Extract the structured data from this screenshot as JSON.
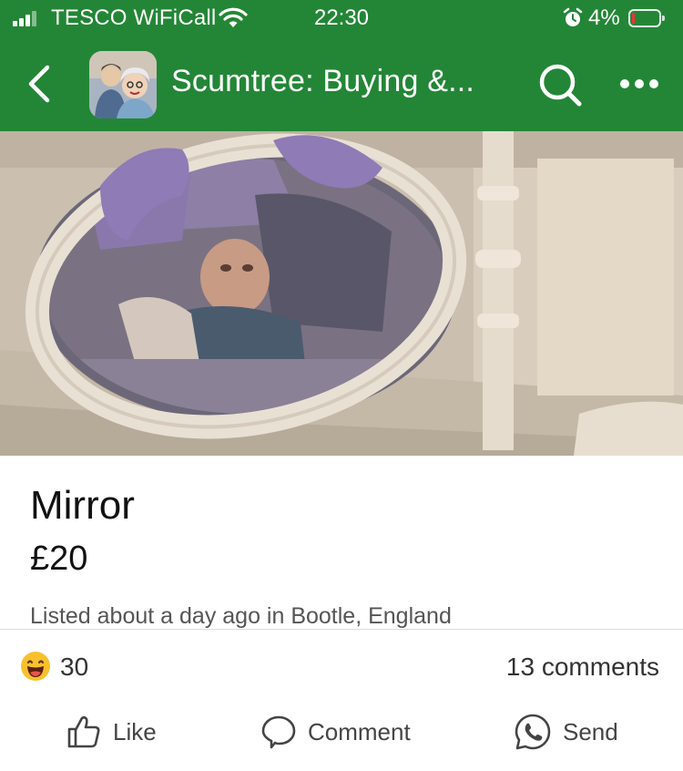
{
  "status_bar": {
    "carrier": "TESCO WiFiCall",
    "time": "22:30",
    "battery_percent": "4%",
    "battery_level": 0.04,
    "icons": [
      "signal-icon",
      "wifi-icon",
      "alarm-icon",
      "battery-icon"
    ]
  },
  "nav": {
    "title": "Scumtree: Buying &...",
    "icons": [
      "back-chevron-icon",
      "group-avatar",
      "search-icon",
      "more-icon"
    ]
  },
  "listing": {
    "title": "Mirror",
    "price": "£20",
    "meta": "Listed about a day ago in Bootle, England"
  },
  "engagement": {
    "reaction_emoji": "laughing-face-icon",
    "reaction_count": "30",
    "comments": "13 comments"
  },
  "actions": {
    "like": "Like",
    "comment": "Comment",
    "send": "Send"
  },
  "colors": {
    "header_bg": "#238636",
    "text_primary": "#111111",
    "text_secondary": "#555555",
    "reaction_yellow": "#f7c12d"
  }
}
